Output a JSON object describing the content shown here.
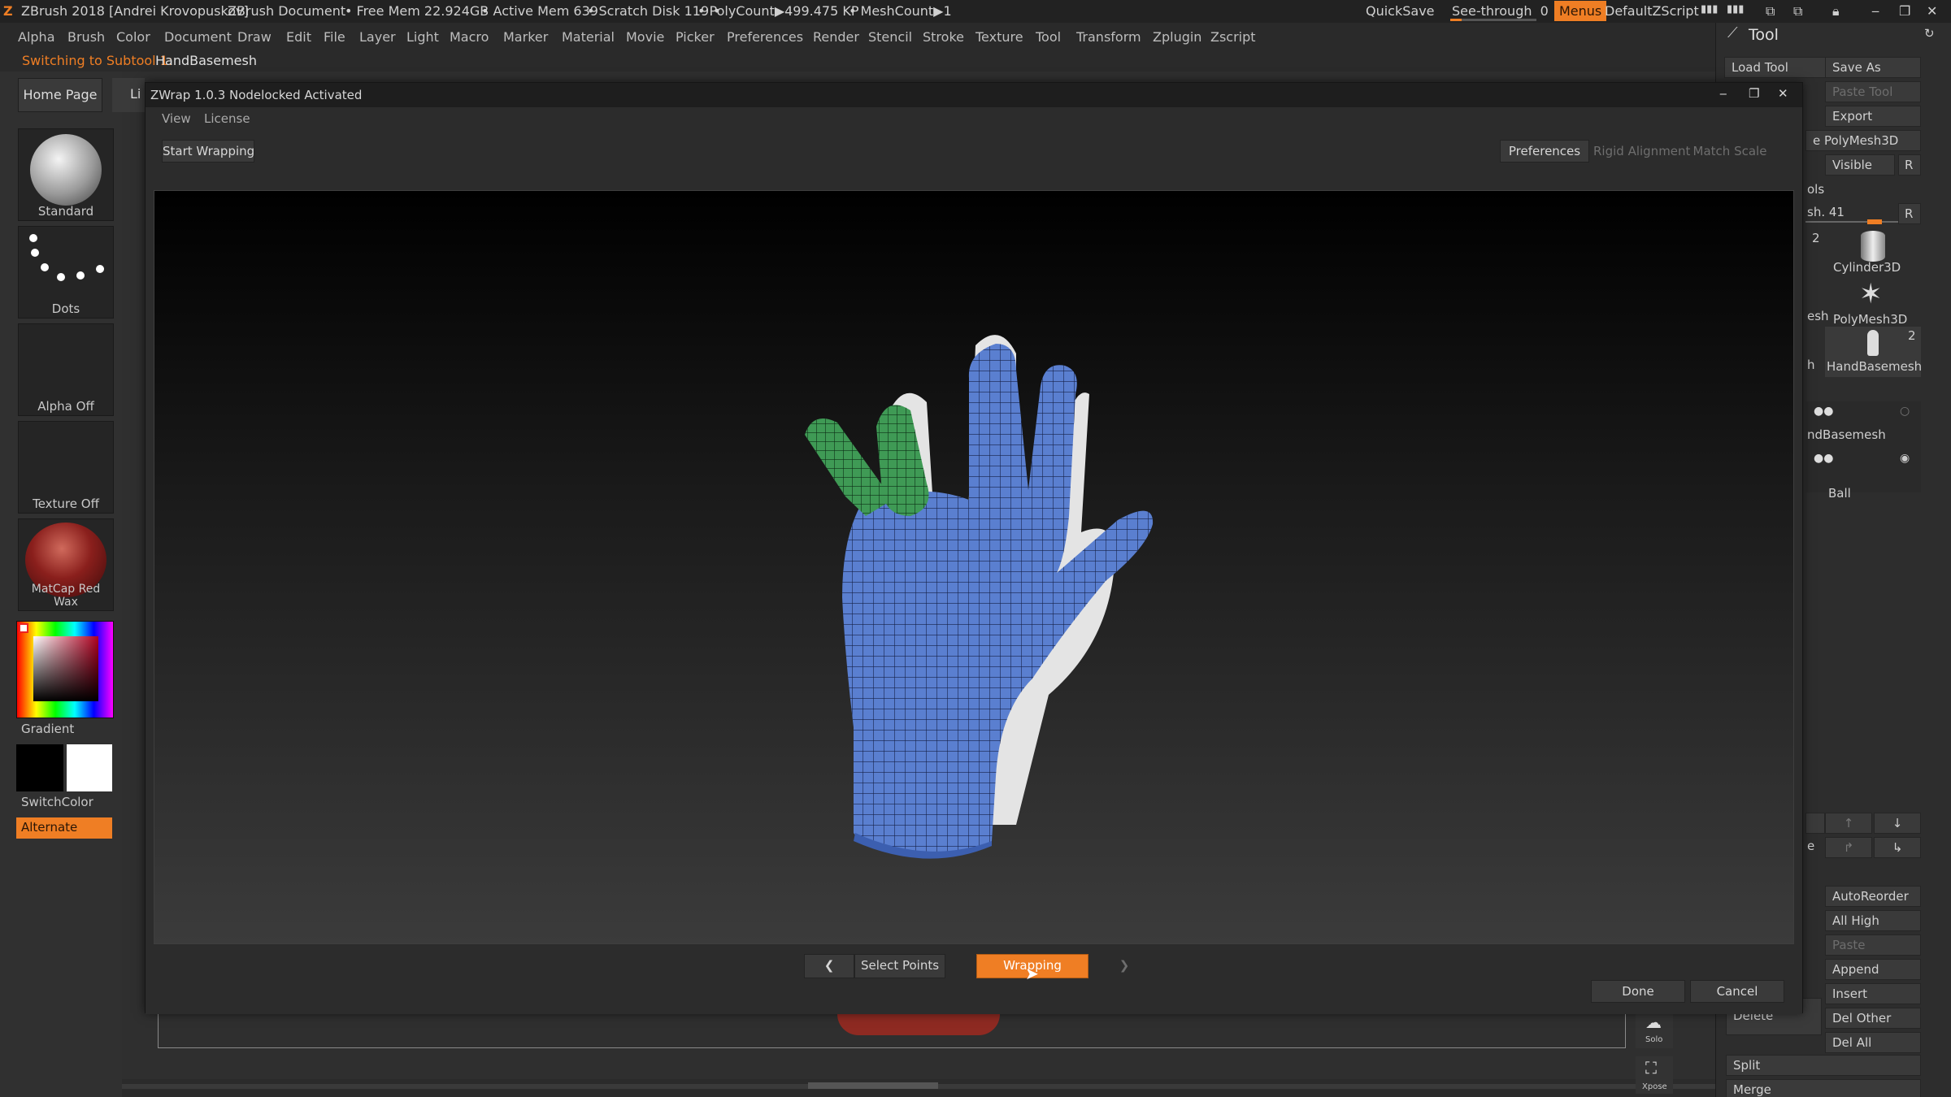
{
  "app": {
    "title": "ZBrush 2018 [Andrei Krovopuskov]",
    "document": "ZBrush Document",
    "free_mem": "• Free Mem 22.924GB",
    "active_mem": "• Active Mem 639",
    "scratch": "• Scratch Disk 119 •",
    "polycount": "• PolyCount▶499.475 KP",
    "meshcount": "• MeshCount▶1",
    "quicksave": "QuickSave",
    "see_through": "See-through",
    "see_through_value": "0",
    "menus": "Menus",
    "default_zscript": "DefaultZScript"
  },
  "menubar": [
    "Alpha",
    "Brush",
    "Color",
    "Document",
    "Draw",
    "Edit",
    "File",
    "Layer",
    "Light",
    "Macro",
    "Marker",
    "Material",
    "Movie",
    "Picker",
    "Preferences",
    "Render",
    "Stencil",
    "Stroke",
    "Texture",
    "Tool",
    "Transform",
    "Zplugin",
    "Zscript"
  ],
  "status": {
    "switching": "Switching to Subtool 1:",
    "subtool": "HandBasemesh"
  },
  "left": {
    "home_page": "Home Page",
    "li_tab": "Li",
    "brush": "Standard",
    "stroke": "Dots",
    "alpha": "Alpha Off",
    "texture": "Texture Off",
    "material": "MatCap Red Wax",
    "gradient": "Gradient",
    "switchcolor": "SwitchColor",
    "alternate": "Alternate"
  },
  "right": {
    "header": "Tool",
    "load_tool": "Load Tool",
    "save_as": "Save As",
    "paste_tool": "Paste Tool",
    "export": "Export",
    "polymesh3d_btn": "e PolyMesh3D",
    "visible": "Visible",
    "r": "R",
    "ols": "ols",
    "sh41": "sh. 41",
    "num2a": "2",
    "cylinder": "Cylinder3D",
    "polymesh": "PolyMesh3D",
    "hand": "HandBasemesh",
    "num2b": "2",
    "esh": "esh",
    "h": "h",
    "ndbasemesh": "ndBasemesh",
    "ball": "Ball",
    "e_label": "e",
    "autoreorder": "AutoReorder",
    "all_high": "All High",
    "paste": "Paste",
    "append": "Append",
    "insert": "Insert",
    "delete": "Delete",
    "del_other": "Del Other",
    "del_all": "Del All",
    "split": "Split",
    "merge": "Merge",
    "solo": "Solo",
    "xpose": "Xpose"
  },
  "zwrap": {
    "title": "ZWrap 1.0.3  Nodelocked Activated",
    "menu": [
      "View",
      "License"
    ],
    "start_wrapping": "Start Wrapping",
    "preferences": "Preferences",
    "rigid_alignment": "Rigid Alignment",
    "match_scale": "Match Scale",
    "select_points": "Select Points",
    "wrapping": "Wrapping",
    "done": "Done",
    "cancel": "Cancel"
  },
  "colors": {
    "accent": "#ef7e24",
    "mesh_blue": "#5a7fd0",
    "mesh_green": "#3f9a55"
  }
}
